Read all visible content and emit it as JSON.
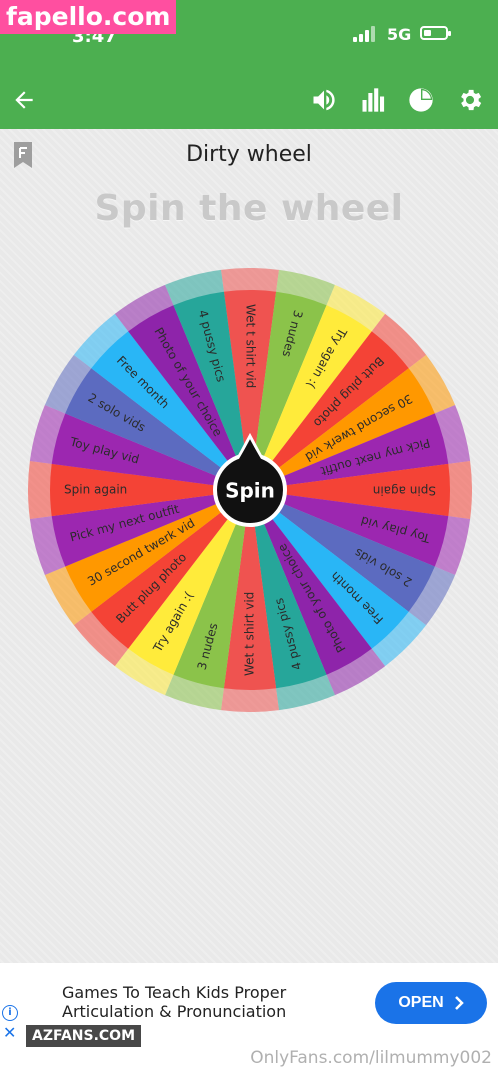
{
  "overlay": {
    "top_watermark": "fapello.com",
    "bottom_left_watermark": "AZFANS.COM",
    "bottom_right_watermark": "OnlyFans.com/lilmummy002"
  },
  "status_bar": {
    "time": "3:47",
    "network": "5G",
    "colors": {
      "bar": "#4caf50"
    }
  },
  "app_bar": {
    "icons": [
      "back-arrow-icon",
      "volume-icon",
      "stats-icon",
      "pie-icon",
      "settings-icon"
    ]
  },
  "page": {
    "title": "Dirty wheel",
    "subtitle": "Spin the wheel"
  },
  "wheel": {
    "center_label": "Spin",
    "slices": [
      "Wet t shirt vid",
      "3 nudes",
      "Try again :(",
      "Butt plug photo",
      "30 second twerk vid",
      "Pick my next outfit",
      "Spin again",
      "Toy play vid",
      "2 solo vids",
      "Free month",
      "Photo of your choice",
      "4 pussy pics",
      "Wet t shirt vid",
      "3 nudes",
      "Try again :(",
      "Butt plug photo",
      "30 second twerk vid",
      "Pick my next outfit",
      "Spin again",
      "Toy play vid",
      "2 solo vids",
      "Free month",
      "Photo of your choice",
      "4 pussy pics"
    ],
    "colors": [
      "#ef5350",
      "#8bc34a",
      "#ffeb3b",
      "#f44336",
      "#ff9800",
      "#9c27b0",
      "#f44336",
      "#9c27b0",
      "#5c6bc0",
      "#29b6f6",
      "#8e24aa",
      "#26a69a"
    ]
  },
  "ad": {
    "line1": "Games To Teach Kids Proper",
    "line2": "Articulation & Pronunciation",
    "button": "OPEN",
    "info_glyph": "i",
    "close_glyph": "✕"
  }
}
